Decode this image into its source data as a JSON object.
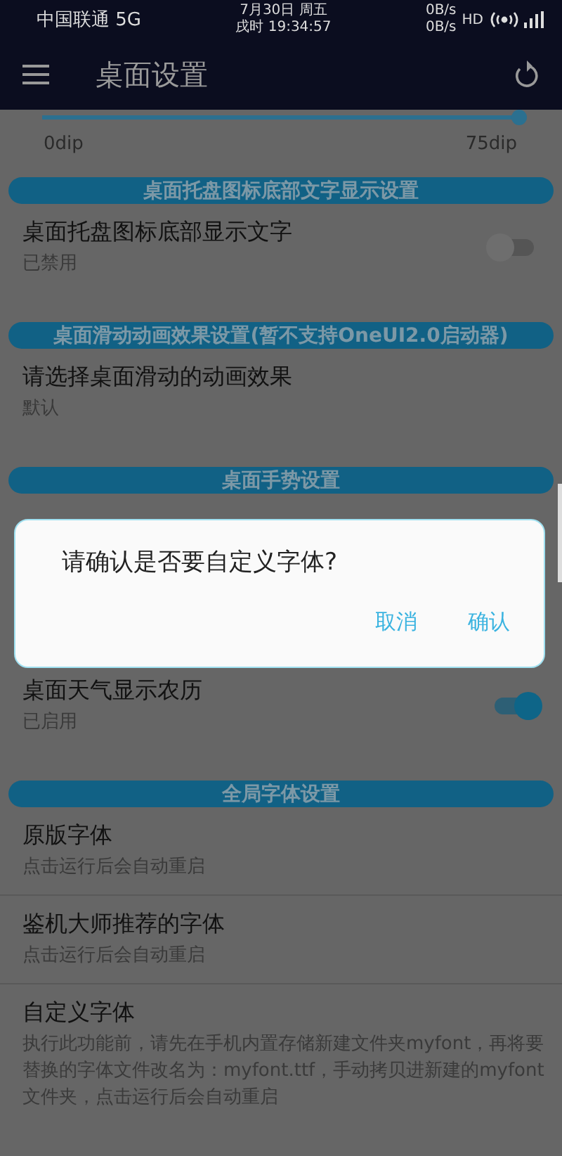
{
  "status_bar": {
    "carrier": "中国联通 5G",
    "date": "7月30日 周五",
    "time": "戌时 19:34:57",
    "speed_up": "0B/s",
    "speed_down": "0B/s",
    "hd": "HD"
  },
  "toolbar": {
    "title": "桌面设置"
  },
  "slider": {
    "level": 1,
    "min_label": "0dip",
    "max_label": "75dip"
  },
  "sections": [
    {
      "header": "桌面托盘图标底部文字显示设置",
      "rows": [
        {
          "kind": "switch",
          "title": "桌面托盘图标底部显示文字",
          "summary": "已禁用",
          "on": false
        }
      ]
    },
    {
      "header": "桌面滑动动画效果设置(暂不支持OneUI2.0启动器)",
      "rows": [
        {
          "kind": "text",
          "title": "请选择桌面滑动的动画效果",
          "summary": "默认"
        }
      ]
    },
    {
      "header": "桌面手势设置"
    },
    {
      "rows": [
        {
          "kind": "switch",
          "title": "桌面天气显示农历",
          "summary": "已启用",
          "on": true
        }
      ]
    },
    {
      "header": "全局字体设置",
      "rows": [
        {
          "kind": "text",
          "title": "原版字体",
          "summary": "点击运行后会自动重启"
        },
        {
          "kind": "text",
          "title": "鉴机大师推荐的字体",
          "summary": "点击运行后会自动重启"
        },
        {
          "kind": "text",
          "title": "自定义字体",
          "summary": "执行此功能前，请先在手机内置存储新建文件夹myfont，再将要替换的字体文件改名为：myfont.ttf，手动拷贝进新建的myfont文件夹，点击运行后会自动重启"
        }
      ]
    }
  ],
  "dialog": {
    "message": "请确认是否要自定义字体?",
    "buttons": [
      "取消",
      "确认"
    ]
  }
}
